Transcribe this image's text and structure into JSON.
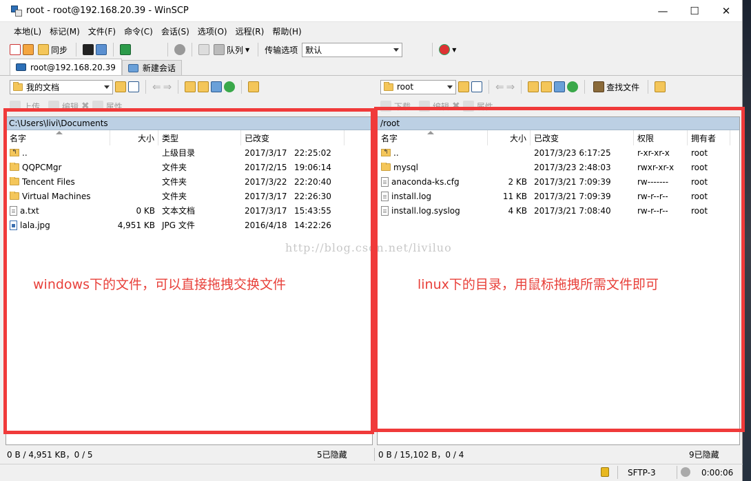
{
  "window": {
    "title": "root - root@192.168.20.39 - WinSCP"
  },
  "menu": [
    "本地(L)",
    "标记(M)",
    "文件(F)",
    "命令(C)",
    "会话(S)",
    "选项(O)",
    "远程(R)",
    "帮助(H)"
  ],
  "toolbar": {
    "sync_label": "同步",
    "queue_label": "队列",
    "transfer_label": "传输选项",
    "transfer_value": "默认"
  },
  "tabs": [
    {
      "label": "root@192.168.20.39"
    },
    {
      "label": "新建会话"
    }
  ],
  "left": {
    "location": "我的文档",
    "actions": {
      "upload": "上传",
      "edit": "编辑",
      "props": "属性"
    },
    "path": "C:\\Users\\livi\\Documents",
    "columns": [
      "名字",
      "大小",
      "类型",
      "已改变"
    ],
    "rows": [
      {
        "icon": "updir",
        "name": "..",
        "size": "",
        "type": "上级目录",
        "date": "2017/3/17",
        "time": "22:25:02"
      },
      {
        "icon": "folder",
        "name": "QQPCMgr",
        "size": "",
        "type": "文件夹",
        "date": "2017/2/15",
        "time": "19:06:14"
      },
      {
        "icon": "folder",
        "name": "Tencent Files",
        "size": "",
        "type": "文件夹",
        "date": "2017/3/22",
        "time": "22:20:40"
      },
      {
        "icon": "folder",
        "name": "Virtual Machines",
        "size": "",
        "type": "文件夹",
        "date": "2017/3/17",
        "time": "22:26:30"
      },
      {
        "icon": "file",
        "name": "a.txt",
        "size": "0 KB",
        "type": "文本文档",
        "date": "2017/3/17",
        "time": "15:43:55"
      },
      {
        "icon": "image",
        "name": "lala.jpg",
        "size": "4,951 KB",
        "type": "JPG 文件",
        "date": "2016/4/18",
        "time": "14:22:26"
      }
    ],
    "status": "0 B / 4,951 KB，0 / 5",
    "hidden": "5已隐藏"
  },
  "right": {
    "location": "root",
    "find_label": "查找文件",
    "actions": {
      "download": "下载",
      "edit": "编辑",
      "props": "属性"
    },
    "path": "/root",
    "columns": [
      "名字",
      "大小",
      "已改变",
      "权限",
      "拥有者"
    ],
    "rows": [
      {
        "icon": "updir",
        "name": "..",
        "size": "",
        "changed": "2017/3/23 6:17:25",
        "perm": "r-xr-xr-x",
        "owner": "root"
      },
      {
        "icon": "folder",
        "name": "mysql",
        "size": "",
        "changed": "2017/3/23 2:48:03",
        "perm": "rwxr-xr-x",
        "owner": "root"
      },
      {
        "icon": "file",
        "name": "anaconda-ks.cfg",
        "size": "2 KB",
        "changed": "2017/3/21 7:09:39",
        "perm": "rw-------",
        "owner": "root"
      },
      {
        "icon": "file",
        "name": "install.log",
        "size": "11 KB",
        "changed": "2017/3/21 7:09:39",
        "perm": "rw-r--r--",
        "owner": "root"
      },
      {
        "icon": "file",
        "name": "install.log.syslog",
        "size": "4 KB",
        "changed": "2017/3/21 7:08:40",
        "perm": "rw-r--r--",
        "owner": "root"
      }
    ],
    "status": "0 B / 15,102 B，0 / 4",
    "hidden": "9已隐藏"
  },
  "annotations": {
    "left_text": "windows下的文件，可以直接拖拽交换文件",
    "right_text": "linux下的目录，用鼠标拖拽所需文件即可",
    "watermark": "http://blog.csdn.net/liviluo"
  },
  "statusbar": {
    "protocol": "SFTP-3",
    "elapsed": "0:00:06"
  },
  "colors": {
    "annotation": "#f03a3a",
    "path_bar": "#bcd0e4"
  }
}
